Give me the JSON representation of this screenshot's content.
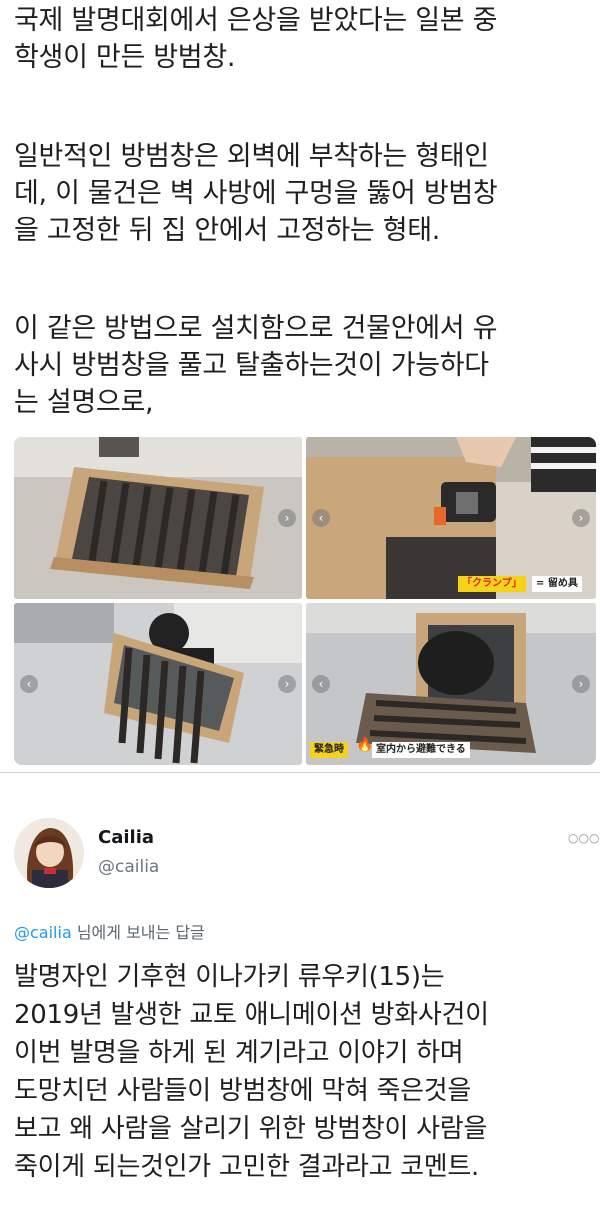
{
  "post": {
    "paragraphs": [
      [
        "국제 발명대회에서 은상을 받았다는 일본 중",
        "학생이 만든 방범창."
      ],
      [
        "일반적인 방범창은 외벽에 부착하는 형태인",
        "데, 이 물건은 벽 사방에 구멍을 뚫어 방범창",
        "을 고정한 뒤 집 안에서 고정하는 형태."
      ],
      [
        "이 같은 방법으로 설치함으로 건물안에서 유",
        "사시 방범창을 풀고 탈출하는것이 가능하다",
        "는 설명으로,"
      ]
    ],
    "photo_captions": {
      "clamp_label": "「クランプ」",
      "clamp_meaning": "= 留め具",
      "emergency_label": "緊急時",
      "emergency_text": "室内から避難できる"
    }
  },
  "reply": {
    "display_name": "Cailia",
    "handle": "@cailia",
    "more_icon": "more-dots-icon",
    "reply_to_handle": "@cailia",
    "reply_to_suffix": " 님에게 보내는 답글",
    "body_lines": [
      "발명자인 기후현 이나가키 류우키(15)는",
      "2019년 발생한 교토 애니메이션 방화사건이",
      "이번 발명을 하게 된 계기라고 이야기 하며",
      "도망치던 사람들이 방범창에 막혀 죽은것을",
      "보고 왜 사람을 살리기 위한 방범창이 사람을",
      "죽이게 되는것인가 고민한 결과라고 코멘트."
    ]
  },
  "colors": {
    "link": "#1d9bf0",
    "caption_yellow": "#f6d21a",
    "caption_red": "#d9231c"
  }
}
